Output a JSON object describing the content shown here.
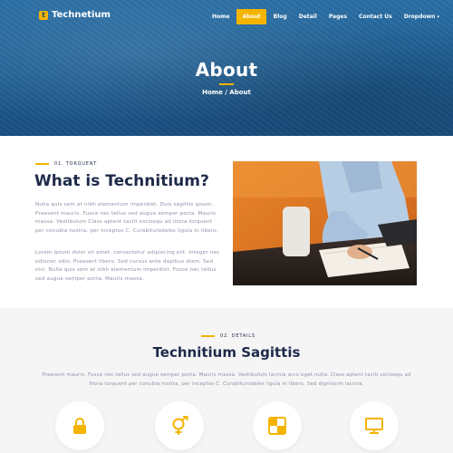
{
  "brand": {
    "logo_letter": "t",
    "name": "Technetium"
  },
  "nav": {
    "items": [
      {
        "label": "Home",
        "active": false
      },
      {
        "label": "About",
        "active": true
      },
      {
        "label": "Blog",
        "active": false
      },
      {
        "label": "Detail",
        "active": false
      },
      {
        "label": "Pages",
        "active": false
      },
      {
        "label": "Contact Us",
        "active": false
      },
      {
        "label": "Dropdown",
        "active": false
      }
    ],
    "dropdown_icon": "chevron-down-icon"
  },
  "hero": {
    "title": "About",
    "breadcrumb": "Home / About"
  },
  "about": {
    "eyebrow": "01. TORQUENT",
    "title": "What is Technitium?",
    "paragraph1": "Nulla quis sem at nibh elementum imperdiet. Duis sagittis ipsum. Praesent mauris. Fusce nec tellus sed augue semper porta. Mauris massa. Vestibulum Class aptent taciti sociosqu ad litora torquent per conubia nostra, per inceptos C. Curabiturodales ligula in libero.",
    "paragraph2": "Lorem ipsum dolor sit amet, consectetur adipiscing elit. Integer nec odionec odio. Praesent libero. Sed cursus ante dapibus diam. Sed nisi. Nulla quis sem at nibh elementum imperdiet. Fusce nec tellus sed augue semper porta. Mauris massa.",
    "image": "person-writing-at-desk"
  },
  "details": {
    "eyebrow": "02. DETAILS",
    "title": "Technitium Sagittis",
    "text": "Praesent mauris. Fusce nec tellus sed augue semper porta. Mauris massa. Vestibulum lacinia arcu eget nulla. Class aptent taciti sociosqu ad litora torquent per conubia nostra, per inceptos C. Curabiturodales ligula in libero. Sed dignissim lacinia.",
    "icons": [
      "lock-icon",
      "gender-icon",
      "checkerboard-icon",
      "monitor-icon"
    ]
  },
  "colors": {
    "accent": "#f4b400",
    "navy": "#1e2a4a",
    "hero_blue": "#1f5f95",
    "muted": "#8a93a6",
    "section_bg": "#f5f5f6"
  }
}
